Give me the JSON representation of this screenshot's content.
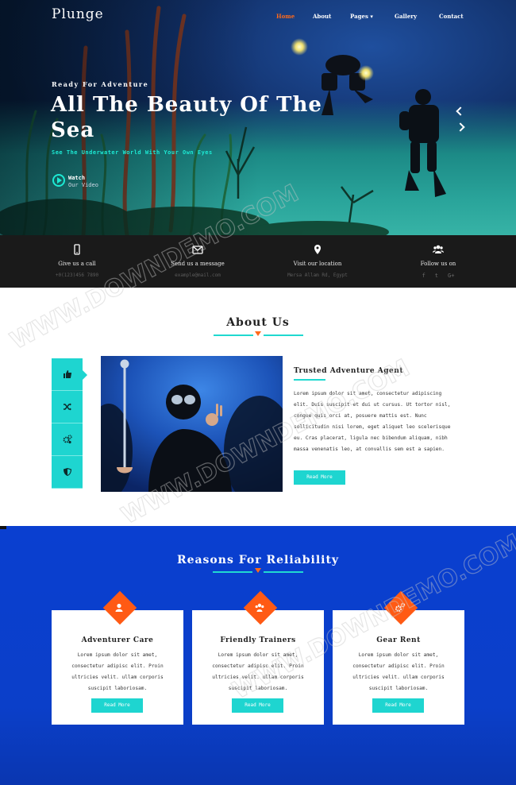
{
  "nav": {
    "logo": "Plunge",
    "items": [
      {
        "label": "Home",
        "active": true
      },
      {
        "label": "About"
      },
      {
        "label": "Pages ▾"
      },
      {
        "label": "Gallery"
      },
      {
        "label": "Contact"
      }
    ]
  },
  "hero": {
    "kicker": "Ready For Adventure",
    "title": "All The Beauty Of The Sea",
    "subtitle": "See The Underwater World With Your Own Eyes",
    "watch_line1": "Watch",
    "watch_line2": "Our Video"
  },
  "contact_bar": [
    {
      "icon": "phone-icon",
      "title": "Give us a call",
      "value": "+0(123)456 7890"
    },
    {
      "icon": "envelope-icon",
      "title": "Send us a message",
      "value": "example@mail.com"
    },
    {
      "icon": "map-pin-icon",
      "title": "Visit our location",
      "value": "Mersa Allam Rd, Egypt"
    },
    {
      "icon": "users-icon",
      "title": "Follow us on",
      "social": [
        "f",
        "t",
        "G+"
      ]
    }
  ],
  "about": {
    "title": "About Us",
    "heading": "Trusted Adventure Agent",
    "text": "Lorem ipsum dolor sit amet, consectetur adipiscing elit. Duis suscipit et dui ut cursus. Ut tortor nisl, congue quis orci at, posuere mattis est. Nunc sollicitudin nisi lorem, eget aliquet leo scelerisque eu. Cras placerat, ligula nec bibendum aliquam, nibh massa venenatis leo, at convallis sem est a sapien.",
    "button": "Read More",
    "tabs": [
      "thumbs-up-icon",
      "shuffle-icon",
      "gears-icon",
      "shield-icon"
    ]
  },
  "reasons": {
    "title": "Reasons For Reliability",
    "cards": [
      {
        "icon": "user-icon",
        "title": "Adventurer Care",
        "text": "Lorem ipsum dolor sit amet, consectetur adipisc elit. Proin ultricies velit. ullam corporis suscipit laboriosam.",
        "button": "Read More"
      },
      {
        "icon": "group-icon",
        "title": "Friendly Trainers",
        "text": "Lorem ipsum dolor sit amet, consectetur adipisc elit. Proin ultricies velit. ullam corporis suscipit laboriosam.",
        "button": "Read More"
      },
      {
        "icon": "gears-icon",
        "title": "Gear Rent",
        "text": "Lorem ipsum dolor sit amet, consectetur adipisc elit. Proin ultricies velit. ullam corporis suscipit laboriosam.",
        "button": "Read More"
      }
    ]
  },
  "colors": {
    "accent_teal": "#1ed5d0",
    "accent_orange": "#ff5a14",
    "reasons_blue": "#0a3fd0",
    "bar_dark": "#1a1a1a"
  },
  "watermark": "WWW.DOWNDEMO.COM"
}
